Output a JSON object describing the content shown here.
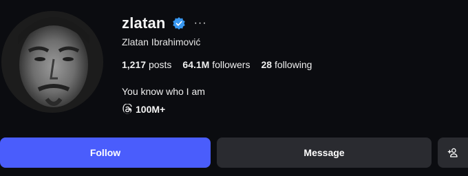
{
  "profile": {
    "username": "zlatan",
    "full_name": "Zlatan Ibrahimović",
    "bio": "You know who I am",
    "threads_count": "100M+"
  },
  "stats": {
    "posts_value": "1,217",
    "posts_label": "posts",
    "followers_value": "64.1M",
    "followers_label": "followers",
    "following_value": "28",
    "following_label": "following"
  },
  "actions": {
    "follow_label": "Follow",
    "message_label": "Message",
    "more_label": "···"
  },
  "icons": {
    "verified": "verified-badge-icon",
    "threads": "threads-icon",
    "add_user": "add-user-icon",
    "more": "more-options-icon"
  },
  "colors": {
    "background": "#0b0c10",
    "follow_button": "#4a5dfc",
    "secondary_button": "#2a2b30",
    "verified": "#3897f0"
  }
}
